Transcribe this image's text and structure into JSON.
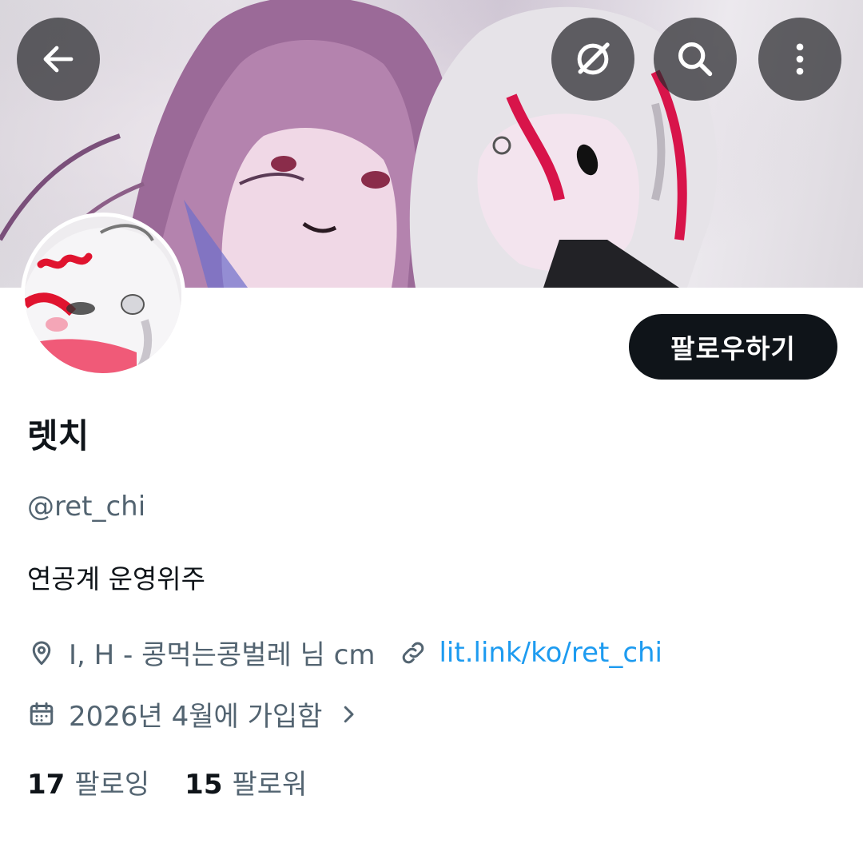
{
  "header": {
    "back_icon": "arrow-left-icon",
    "grok_icon": "grok-icon",
    "search_icon": "search-icon",
    "more_icon": "more-vertical-icon"
  },
  "profile": {
    "follow_label": "팔로우하기",
    "name": "렛치",
    "handle": "@ret_chi",
    "bio": "연공계 운영위주",
    "location": "I, H - 콩먹는콩벌레 님 cm",
    "website": "lit.link/ko/ret_chi",
    "joined": "2026년 4월에 가입함",
    "following_count": "17",
    "following_label": "팔로잉",
    "followers_count": "15",
    "followers_label": "팔로워"
  },
  "colors": {
    "text_primary": "#0f1419",
    "text_secondary": "#536471",
    "link": "#1d9bf0",
    "button_bg": "#0f1419"
  }
}
